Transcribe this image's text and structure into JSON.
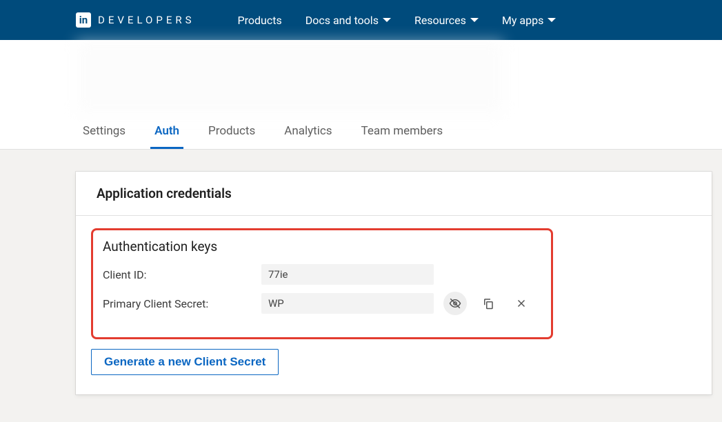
{
  "brand": {
    "icon_letters": "in",
    "text": "DEVELOPERS"
  },
  "nav": {
    "items": [
      {
        "label": "Products",
        "has_caret": false
      },
      {
        "label": "Docs and tools",
        "has_caret": true
      },
      {
        "label": "Resources",
        "has_caret": true
      },
      {
        "label": "My apps",
        "has_caret": true
      }
    ]
  },
  "tabs": [
    {
      "label": "Settings",
      "active": false
    },
    {
      "label": "Auth",
      "active": true
    },
    {
      "label": "Products",
      "active": false
    },
    {
      "label": "Analytics",
      "active": false
    },
    {
      "label": "Team members",
      "active": false
    }
  ],
  "card": {
    "title": "Application credentials",
    "auth_keys_title": "Authentication keys",
    "client_id_label": "Client ID:",
    "client_id_value": "77ie",
    "client_secret_label": "Primary Client Secret:",
    "client_secret_value": "WP",
    "generate_label": "Generate a new Client Secret"
  }
}
